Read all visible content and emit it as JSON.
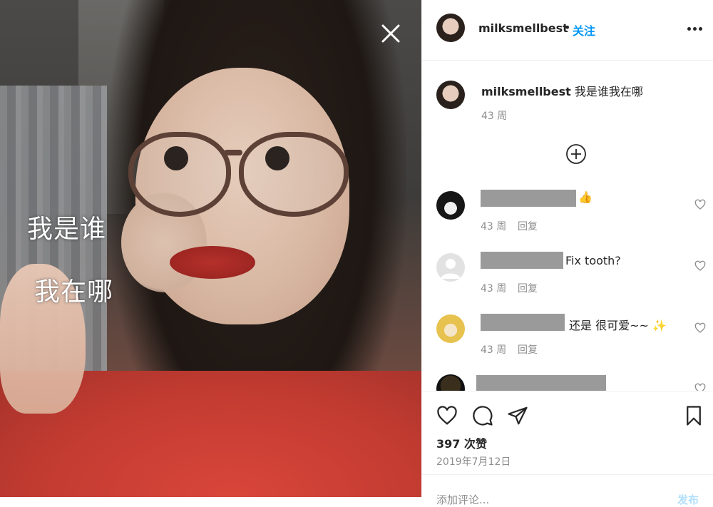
{
  "post": {
    "sticker_line1": "我是谁",
    "sticker_line2": "我在哪",
    "close_icon": "close-icon"
  },
  "header": {
    "username": "milksmellbest",
    "dot": "•",
    "follow_label": "关注",
    "more_icon": "more-horizontal-icon"
  },
  "caption": {
    "username": "milksmellbest",
    "text": "我是谁我在哪",
    "time": "43 周"
  },
  "comments": [
    {
      "text": "👍",
      "time": "43 周",
      "reply_label": "回复"
    },
    {
      "text": "Fix tooth?",
      "time": "43 周",
      "reply_label": "回复"
    },
    {
      "text": "还是 很可爱~~ ✨",
      "time": "43 周",
      "reply_label": "回复"
    },
    {
      "text": "",
      "time": "",
      "reply_label": ""
    }
  ],
  "actions": {
    "like_icon": "heart-icon",
    "comment_icon": "comment-icon",
    "share_icon": "share-icon",
    "save_icon": "bookmark-icon",
    "likes": "397 次赞",
    "date": "2019年7月12日"
  },
  "add_comment": {
    "placeholder": "添加评论...",
    "post_label": "发布"
  },
  "colors": {
    "accent": "#0095f6",
    "text": "#262626",
    "muted": "#8e8e8e"
  }
}
